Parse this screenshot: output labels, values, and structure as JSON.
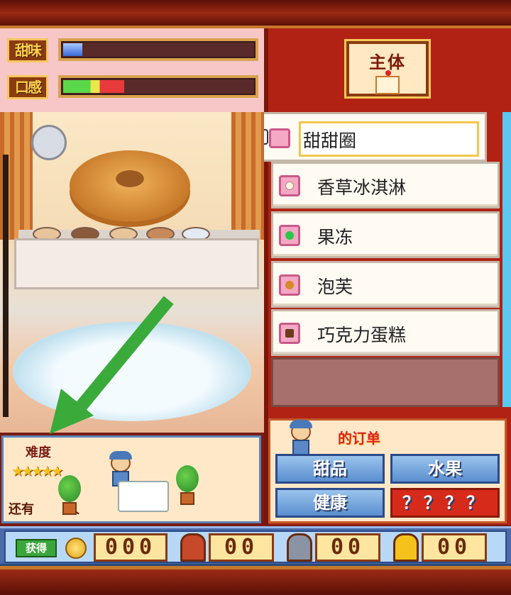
{
  "stats": {
    "sweetness_label": "甜味",
    "sweetness_level": 0.1,
    "texture_label": "口感",
    "texture_level": 0.32
  },
  "main_button": {
    "label": "主体"
  },
  "menu": {
    "selected": "甜甜圈",
    "items": [
      {
        "label": "香草冰淇淋",
        "icon": "ice-cream-icon"
      },
      {
        "label": "果冻",
        "icon": "jelly-icon"
      },
      {
        "label": "泡芙",
        "icon": "cream-puff-icon"
      },
      {
        "label": "巧克力蛋糕",
        "icon": "chocolate-cake-icon"
      }
    ]
  },
  "difficulty": {
    "label": "难度",
    "stars": "★★★★★"
  },
  "remaining": {
    "prefix": "还有",
    "unit": "人"
  },
  "orders": {
    "title": "的订单",
    "tags": [
      "甜品",
      "水果",
      "健康",
      "？？？？"
    ]
  },
  "footer": {
    "obtain_label": "获得",
    "coins": "000",
    "box1": "00",
    "box2": "00",
    "box3": "00"
  },
  "colors": {
    "accent": "#b22214",
    "tag_blue": "#5a8ed0",
    "tag_red": "#d62a1a",
    "arrow": "#3aaa3a"
  }
}
